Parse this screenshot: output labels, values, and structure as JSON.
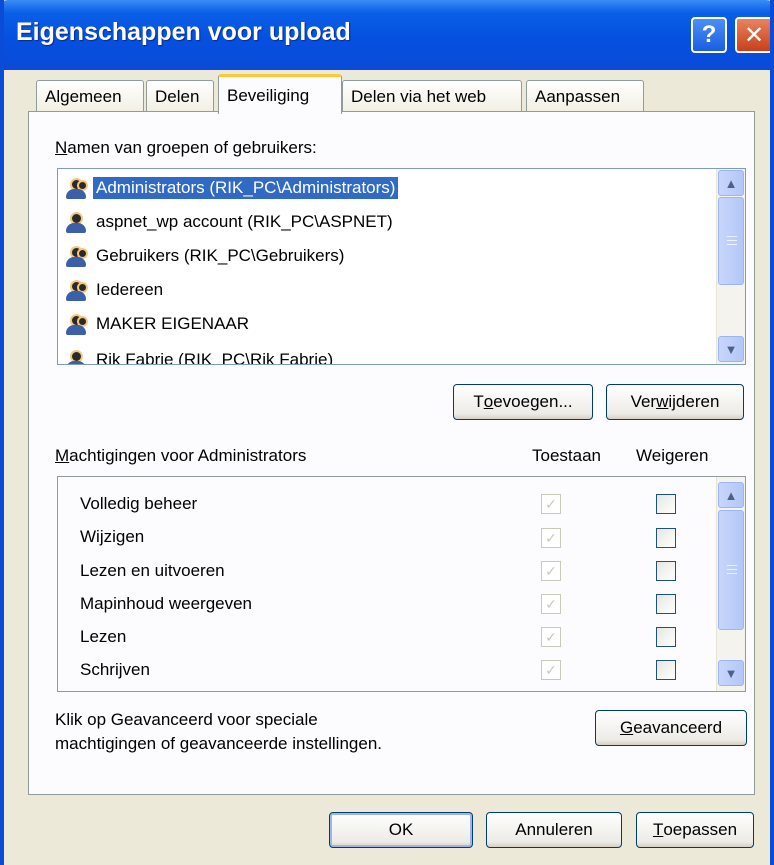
{
  "window": {
    "title": "Eigenschappen voor upload",
    "help": "?",
    "close": "✕"
  },
  "tabs": [
    {
      "label": "Algemeen"
    },
    {
      "label": "Delen"
    },
    {
      "label": "Beveiliging"
    },
    {
      "label": "Delen via het web"
    },
    {
      "label": "Aanpassen"
    }
  ],
  "active_tab": "Beveiliging",
  "users": {
    "label_accel": "N",
    "label_rest": "amen van groepen of gebruikers:",
    "items": [
      {
        "name": "Administrators (RIK_PC\\Administrators)",
        "icon": "group-icon",
        "selected": true
      },
      {
        "name": "aspnet_wp account (RIK_PC\\ASPNET)",
        "icon": "user-icon",
        "selected": false
      },
      {
        "name": "Gebruikers (RIK_PC\\Gebruikers)",
        "icon": "group-icon",
        "selected": false
      },
      {
        "name": "Iedereen",
        "icon": "group-icon",
        "selected": false
      },
      {
        "name": "MAKER EIGENAAR",
        "icon": "group-icon",
        "selected": false
      },
      {
        "name": "Rik Fabrie (RIK_PC\\Rik Fabrie)",
        "icon": "user-icon",
        "selected": false
      }
    ]
  },
  "add_button": {
    "pre": "T",
    "accel": "o",
    "post": "evoegen..."
  },
  "remove_button": {
    "pre": "Ver",
    "accel": "w",
    "post": "ijderen"
  },
  "permissions": {
    "label_accel": "M",
    "label_rest": "achtigingen voor Administrators",
    "allow_header": "Toestaan",
    "deny_header": "Weigeren",
    "items": [
      {
        "name": "Volledig beheer",
        "allow": true,
        "deny": false
      },
      {
        "name": "Wijzigen",
        "allow": true,
        "deny": false
      },
      {
        "name": "Lezen en uitvoeren",
        "allow": true,
        "deny": false
      },
      {
        "name": "Mapinhoud weergeven",
        "allow": true,
        "deny": false
      },
      {
        "name": "Lezen",
        "allow": true,
        "deny": false
      },
      {
        "name": "Schrijven",
        "allow": true,
        "deny": false
      }
    ]
  },
  "advanced_note": {
    "line1": "Klik op Geavanceerd voor speciale",
    "line2": "machtigingen of geavanceerde instellingen."
  },
  "advanced_button": {
    "accel": "G",
    "post": "eavanceerd"
  },
  "footer": {
    "ok": "OK",
    "cancel": "Annuleren",
    "apply_accel": "T",
    "apply_rest": "oepassen"
  }
}
